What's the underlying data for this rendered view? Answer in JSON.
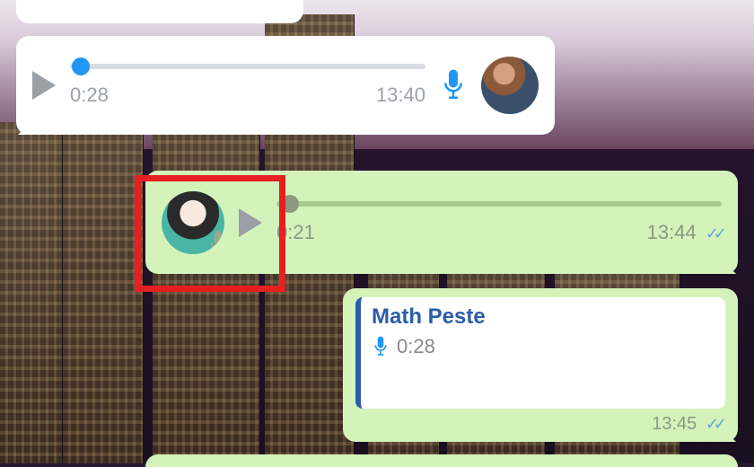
{
  "messages": {
    "incoming_voice": {
      "duration": "0:28",
      "timestamp": "13:40",
      "progress_position": "3%"
    },
    "outgoing_voice": {
      "duration": "0:21",
      "timestamp": "13:44",
      "progress_position": "3%"
    },
    "reply": {
      "quoted_name": "Math Peste",
      "quoted_duration": "0:28",
      "timestamp": "13:45"
    }
  },
  "colors": {
    "incoming_bg": "#ffffff",
    "outgoing_bg": "#d4f3bb",
    "accent_blue": "#2196f3",
    "reply_accent": "#2a5caa",
    "highlight_red": "#e62020"
  }
}
